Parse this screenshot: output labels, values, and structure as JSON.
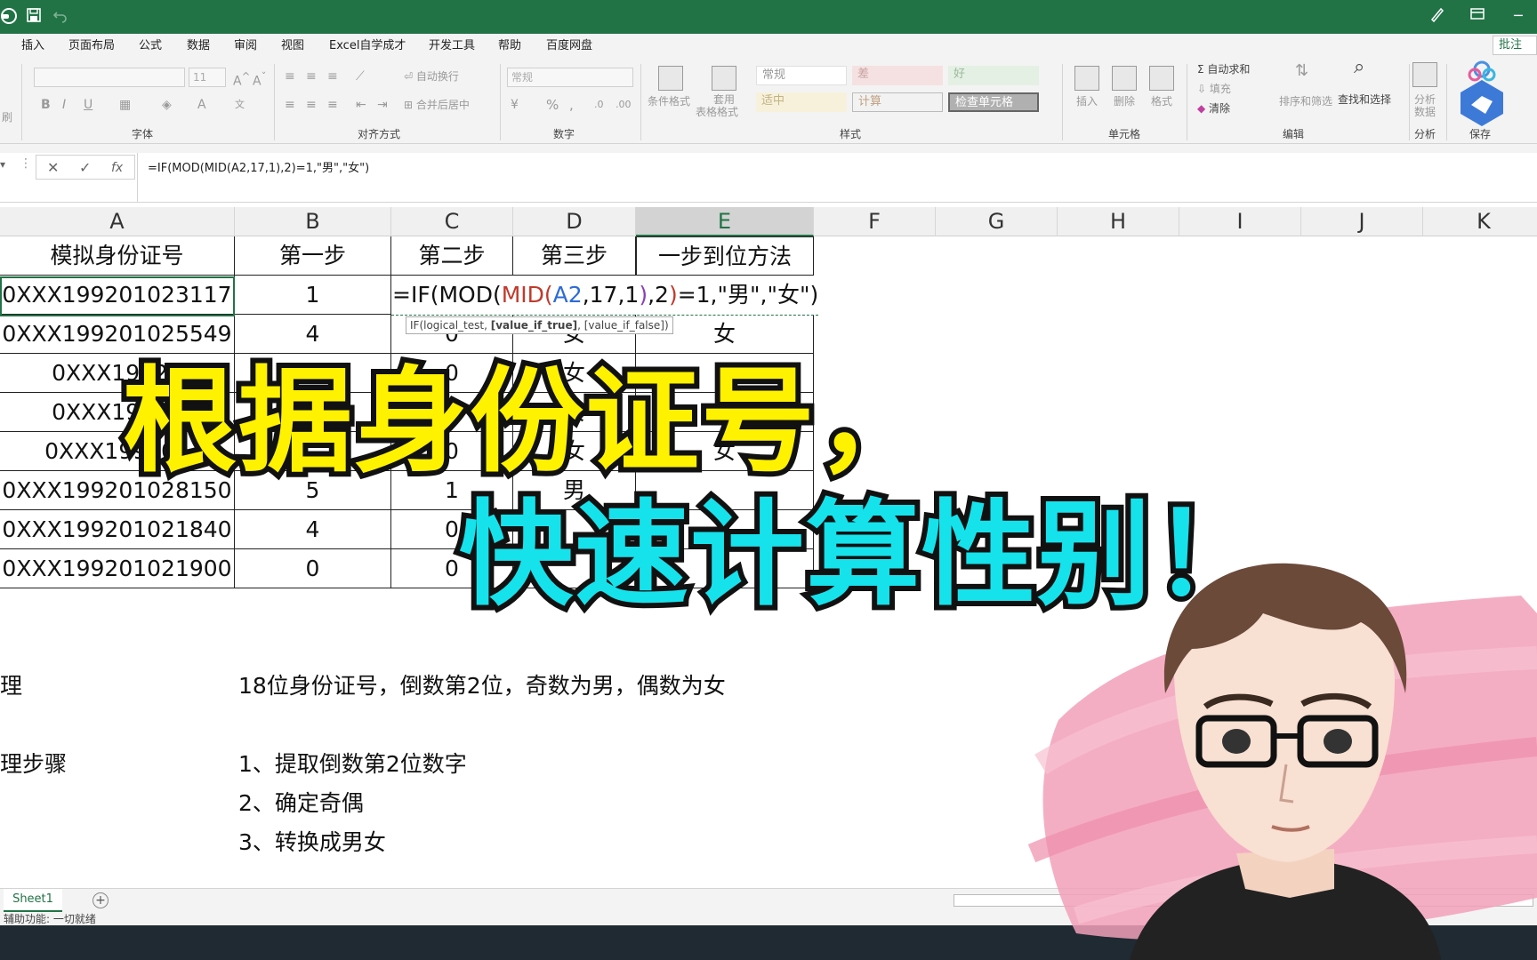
{
  "colors": {
    "excel_green": "#217346",
    "caption1": "#fff200",
    "caption2": "#16e2ec",
    "pink_brush": "#f2a0b8"
  },
  "titlebar": {
    "app_icon": "autosave-icon",
    "min_label": "─",
    "restore_label": "⊡"
  },
  "menu": {
    "tabs": [
      "插入",
      "页面布局",
      "公式",
      "数据",
      "审阅",
      "视图",
      "Excel自学成才",
      "开发工具",
      "帮助",
      "百度网盘"
    ],
    "comment_button": "批注"
  },
  "ribbon": {
    "font_size_value": "11",
    "font_group": "字体",
    "align_group": "对齐方式",
    "wrap_text": "自动换行",
    "merge_center": "合并后居中",
    "number_format": "常规",
    "number_group": "数字",
    "cond_format": "条件格式",
    "table_format_1": "套用",
    "table_format_2": "表格格式",
    "styles": {
      "normal": "常规",
      "bad": "差",
      "good": "好",
      "neutral": "适中",
      "calc": "计算",
      "check": "检查单元格"
    },
    "style_group": "样式",
    "insert": "插入",
    "delete": "删除",
    "format": "格式",
    "cells_group": "单元格",
    "autosum": "自动求和",
    "fill": "填充",
    "clear": "清除",
    "sort_filter": "排序和筛选",
    "find_select": "查找和选择",
    "edit_group": "编辑",
    "analyze_1": "分析",
    "analyze_2": "数据",
    "analyze_group": "分析",
    "save_group": "保存",
    "cut_label": "刷"
  },
  "formula_bar": {
    "formula": "=IF(MOD(MID(A2,17,1),2)=1,\"男\",\"女\")"
  },
  "columns": [
    "A",
    "B",
    "C",
    "D",
    "E",
    "F",
    "G",
    "H",
    "I",
    "J",
    "K"
  ],
  "headers": [
    "模拟身份证号",
    "第一步",
    "第二步",
    "第三步",
    "一步到位方法"
  ],
  "rows": [
    {
      "a": "0XXX199201025549",
      "b": "4",
      "c": "0",
      "d": "女",
      "e": "女"
    },
    {
      "a": "0XXX19920",
      "b": "",
      "c": "0",
      "d": "女",
      "e": ""
    },
    {
      "a": "0XXX19920",
      "b": "",
      "c": "",
      "d": "女",
      "e": ""
    },
    {
      "a": "0XXX199201",
      "b": "",
      "c": "0",
      "d": "女",
      "e": "女"
    },
    {
      "a": "0XXX199201028150",
      "b": "5",
      "c": "1",
      "d": "男",
      "e": ""
    },
    {
      "a": "0XXX199201021840",
      "b": "4",
      "c": "0",
      "d": "",
      "e": ""
    },
    {
      "a": "0XXX199201021900",
      "b": "0",
      "c": "0",
      "d": "",
      "e": ""
    }
  ],
  "active_row": {
    "a": "0XXX199201023117",
    "b": "1"
  },
  "edit": {
    "p1": "=IF(MOD(",
    "p2": "MID(",
    "p3": "A2",
    "p4": ",17,1",
    "p5": ")",
    "p6": ",2",
    "p7": ")",
    "p8": "=1,\"男\",\"女\")"
  },
  "tooltip": {
    "t1": "IF(logical_test, ",
    "t2": "[value_if_true]",
    "t3": ", [value_if_false])"
  },
  "notes": {
    "label1": "理",
    "text1": "18位身份证号，倒数第2位，奇数为男，偶数为女",
    "label2": "理步骤",
    "step1": "1、提取倒数第2位数字",
    "step2": "2、确定奇偶",
    "step3": "3、转换成男女"
  },
  "sheet": {
    "tab": "Sheet1",
    "add": "+"
  },
  "status": {
    "text": "辅助功能: 一切就绪"
  },
  "caption": {
    "line1": "根据身份证号，",
    "line2": "快速计算性别！"
  }
}
